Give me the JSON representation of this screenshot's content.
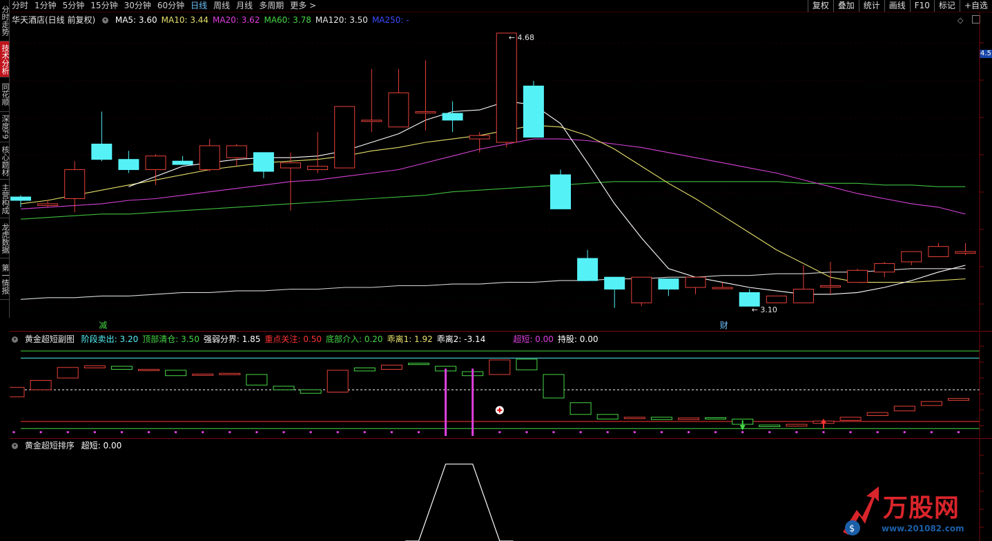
{
  "toolbar": {
    "periods": [
      "分时",
      "1分钟",
      "5分钟",
      "15分钟",
      "30分钟",
      "60分钟",
      "日线",
      "周线",
      "月线",
      "多周期",
      "更多 >"
    ],
    "active_period": "日线",
    "right_buttons": [
      "复权",
      "叠加",
      "统计",
      "画线",
      "F10",
      "标记",
      "+自选"
    ]
  },
  "side_tabs": [
    {
      "label": "分时走势",
      "active": false
    },
    {
      "label": "技术分析",
      "active": true
    },
    {
      "label": "同花顺",
      "active": false
    },
    {
      "label": "深度F9",
      "active": false
    },
    {
      "label": "核心题材",
      "active": false
    },
    {
      "label": "主营构成",
      "active": false
    },
    {
      "label": "龙虎数据",
      "active": false
    },
    {
      "label": "第一情报",
      "active": false
    }
  ],
  "main_header": {
    "stock": "华天酒店(日线 前复权)",
    "ma": [
      {
        "label": "MA5: 3.60",
        "color": "#ffffff"
      },
      {
        "label": "MA10: 3.44",
        "color": "#e6e06a"
      },
      {
        "label": "MA20: 3.62",
        "color": "#e040e0"
      },
      {
        "label": "MA60: 3.78",
        "color": "#46d846"
      },
      {
        "label": "MA120: 3.50",
        "color": "#e6e6e6"
      },
      {
        "label": "MA250: -",
        "color": "#3a4cff"
      }
    ]
  },
  "price_tag": "4.5",
  "colors": {
    "up": "#e8413a",
    "down": "#54f2f7",
    "ma5": "#ffffff",
    "ma10": "#e6e06a",
    "ma20": "#d642d6",
    "ma60": "#3fbf3f",
    "ma120": "#d8d8d8"
  },
  "chart_data": [
    {
      "type": "candlestick",
      "title": "华天酒店(日线 前复权)",
      "candles": [
        {
          "o": 3.72,
          "h": 3.73,
          "l": 3.66,
          "c": 3.7
        },
        {
          "o": 3.67,
          "h": 3.7,
          "l": 3.66,
          "c": 3.68
        },
        {
          "o": 3.71,
          "h": 3.93,
          "l": 3.63,
          "c": 3.88
        },
        {
          "o": 4.03,
          "h": 4.22,
          "l": 3.93,
          "c": 3.94
        },
        {
          "o": 3.94,
          "h": 3.99,
          "l": 3.86,
          "c": 3.88
        },
        {
          "o": 3.88,
          "h": 3.97,
          "l": 3.79,
          "c": 3.96
        },
        {
          "o": 3.93,
          "h": 3.96,
          "l": 3.91,
          "c": 3.91
        },
        {
          "o": 3.88,
          "h": 4.06,
          "l": 3.87,
          "c": 4.02
        },
        {
          "o": 3.95,
          "h": 4.03,
          "l": 3.9,
          "c": 4.02
        },
        {
          "o": 3.98,
          "h": 3.98,
          "l": 3.83,
          "c": 3.87
        },
        {
          "o": 3.89,
          "h": 3.98,
          "l": 3.64,
          "c": 3.92
        },
        {
          "o": 3.88,
          "h": 4.1,
          "l": 3.86,
          "c": 3.9
        },
        {
          "o": 3.89,
          "h": 4.25,
          "l": 3.89,
          "c": 4.25
        },
        {
          "o": 4.17,
          "h": 4.47,
          "l": 4.1,
          "c": 4.17
        },
        {
          "o": 4.13,
          "h": 4.47,
          "l": 4.13,
          "c": 4.33
        },
        {
          "o": 4.22,
          "h": 4.52,
          "l": 4.11,
          "c": 4.22
        },
        {
          "o": 4.21,
          "h": 4.28,
          "l": 4.1,
          "c": 4.17
        },
        {
          "o": 4.06,
          "h": 4.1,
          "l": 3.98,
          "c": 4.08
        },
        {
          "o": 4.04,
          "h": 4.68,
          "l": 4.01,
          "c": 4.68
        },
        {
          "o": 4.37,
          "h": 4.4,
          "l": 4.07,
          "c": 4.07
        },
        {
          "o": 3.85,
          "h": 3.88,
          "l": 3.69,
          "c": 3.65
        },
        {
          "o": 3.36,
          "h": 3.41,
          "l": 3.23,
          "c": 3.23
        },
        {
          "o": 3.25,
          "h": 3.25,
          "l": 3.07,
          "c": 3.18
        },
        {
          "o": 3.1,
          "h": 3.25,
          "l": 3.08,
          "c": 3.25
        },
        {
          "o": 3.24,
          "h": 3.24,
          "l": 3.14,
          "c": 3.18
        },
        {
          "o": 3.19,
          "h": 3.25,
          "l": 3.15,
          "c": 3.25
        },
        {
          "o": 3.19,
          "h": 3.22,
          "l": 3.18,
          "c": 3.19
        },
        {
          "o": 3.16,
          "h": 3.18,
          "l": 3.08,
          "c": 3.08
        },
        {
          "o": 3.1,
          "h": 3.14,
          "l": 3.1,
          "c": 3.14
        },
        {
          "o": 3.1,
          "h": 3.32,
          "l": 3.1,
          "c": 3.18
        },
        {
          "o": 3.2,
          "h": 3.34,
          "l": 3.15,
          "c": 3.2
        },
        {
          "o": 3.22,
          "h": 3.3,
          "l": 3.22,
          "c": 3.29
        },
        {
          "o": 3.28,
          "h": 3.34,
          "l": 3.25,
          "c": 3.33
        },
        {
          "o": 3.34,
          "h": 3.4,
          "l": 3.32,
          "c": 3.4
        },
        {
          "o": 3.37,
          "h": 3.45,
          "l": 3.37,
          "c": 3.43
        },
        {
          "o": 3.39,
          "h": 3.45,
          "l": 3.38,
          "c": 3.4
        }
      ],
      "ma5": [
        null,
        null,
        null,
        null,
        3.78,
        3.84,
        3.9,
        3.92,
        3.94,
        3.95,
        3.95,
        3.96,
        3.99,
        4.04,
        4.09,
        4.17,
        4.22,
        4.23,
        4.28,
        4.26,
        4.15,
        3.92,
        3.68,
        3.48,
        3.3,
        3.25,
        3.22,
        3.19,
        3.17,
        3.15,
        3.15,
        3.16,
        3.19,
        3.23,
        3.28,
        3.32
      ],
      "ma10": [
        3.68,
        3.7,
        3.73,
        3.76,
        3.79,
        3.82,
        3.85,
        3.88,
        3.9,
        3.92,
        3.93,
        3.94,
        3.96,
        3.99,
        4.01,
        4.04,
        4.06,
        4.08,
        4.11,
        4.14,
        4.13,
        4.08,
        4.0,
        3.9,
        3.8,
        3.71,
        3.61,
        3.51,
        3.41,
        3.33,
        3.25,
        3.22,
        3.22,
        3.22,
        3.23,
        3.24
      ],
      "ma20": [
        3.65,
        3.66,
        3.67,
        3.68,
        3.7,
        3.71,
        3.73,
        3.75,
        3.77,
        3.79,
        3.81,
        3.82,
        3.84,
        3.86,
        3.88,
        3.92,
        3.96,
        4.0,
        4.03,
        4.06,
        4.06,
        4.05,
        4.03,
        4.01,
        3.98,
        3.95,
        3.92,
        3.89,
        3.86,
        3.82,
        3.78,
        3.74,
        3.71,
        3.68,
        3.66,
        3.62
      ],
      "ma60": [
        3.59,
        3.6,
        3.61,
        3.62,
        3.62,
        3.63,
        3.64,
        3.65,
        3.66,
        3.67,
        3.68,
        3.69,
        3.7,
        3.71,
        3.72,
        3.73,
        3.75,
        3.76,
        3.77,
        3.78,
        3.79,
        3.8,
        3.81,
        3.81,
        3.81,
        3.81,
        3.81,
        3.81,
        3.81,
        3.8,
        3.8,
        3.8,
        3.79,
        3.79,
        3.78,
        3.78
      ],
      "ma120": [
        3.12,
        3.13,
        3.13,
        3.14,
        3.14,
        3.15,
        3.16,
        3.16,
        3.17,
        3.17,
        3.18,
        3.18,
        3.19,
        3.19,
        3.2,
        3.2,
        3.21,
        3.21,
        3.22,
        3.22,
        3.23,
        3.23,
        3.24,
        3.24,
        3.25,
        3.25,
        3.26,
        3.26,
        3.27,
        3.27,
        3.28,
        3.28,
        3.29,
        3.3,
        3.3,
        3.3
      ],
      "ylim": [
        3.02,
        4.72
      ],
      "annotations": [
        {
          "text": "4.68",
          "index": 18,
          "value": 4.68
        },
        {
          "text": "3.10",
          "index": 27,
          "value": 3.08
        },
        {
          "text": "减",
          "index": 3,
          "kind": "signal",
          "color": "#46d846"
        },
        {
          "text": "财",
          "index": 26,
          "kind": "signal",
          "color": "#6ec3ff"
        }
      ]
    },
    {
      "type": "bar",
      "title": "黄金超短副图",
      "header_items": [
        {
          "label": "阶段卖出: 3.20",
          "color": "#54f2f7"
        },
        {
          "label": "顶部清仓: 3.50",
          "color": "#46d846"
        },
        {
          "label": "强弱分界: 1.85",
          "color": "#ffffff"
        },
        {
          "label": "重点关注: 0.50",
          "color": "#ff3333"
        },
        {
          "label": "底部介入: 0.20",
          "color": "#46d846"
        },
        {
          "label": "乖离1: 1.92",
          "color": "#e6e06a"
        },
        {
          "label": "乖离2: -3.14",
          "color": "#ffffff"
        },
        {
          "label": "超短: 0.00",
          "color": "#e040e0"
        },
        {
          "label": "持股: 0.00",
          "color": "#ffffff"
        }
      ],
      "ref_lines": [
        {
          "value": 3.5,
          "color": "#46d846"
        },
        {
          "value": 3.2,
          "color": "#54f2f7"
        },
        {
          "value": 1.85,
          "color": "#ffffff",
          "dash": true
        },
        {
          "value": 0.5,
          "color": "#ff3333"
        },
        {
          "value": 0.2,
          "color": "#46d846"
        }
      ],
      "boxes": [
        {
          "o": 1.55,
          "c": 1.95,
          "up": true
        },
        {
          "o": 1.85,
          "c": 2.25,
          "up": true
        },
        {
          "o": 2.35,
          "c": 2.8,
          "up": true
        },
        {
          "o": 2.78,
          "c": 2.87,
          "up": true
        },
        {
          "o": 2.85,
          "c": 2.72,
          "up": false
        },
        {
          "o": 2.72,
          "c": 2.7,
          "up": true
        },
        {
          "o": 2.68,
          "c": 2.45,
          "up": false
        },
        {
          "o": 2.48,
          "c": 2.52,
          "up": true
        },
        {
          "o": 2.52,
          "c": 2.55,
          "up": true
        },
        {
          "o": 2.5,
          "c": 2.05,
          "up": false
        },
        {
          "o": 2.0,
          "c": 1.85,
          "up": false
        },
        {
          "o": 1.85,
          "c": 1.7,
          "up": false
        },
        {
          "o": 1.75,
          "c": 2.68,
          "up": true
        },
        {
          "o": 2.78,
          "c": 2.65,
          "up": false
        },
        {
          "o": 2.72,
          "c": 2.9,
          "up": true
        },
        {
          "o": 2.95,
          "c": 2.98,
          "up": false
        },
        {
          "o": 2.85,
          "c": 2.65,
          "up": false
        },
        {
          "o": 2.62,
          "c": 2.45,
          "up": false
        },
        {
          "o": 2.5,
          "c": 3.12,
          "up": true
        },
        {
          "o": 3.15,
          "c": 2.7,
          "up": false
        },
        {
          "o": 2.5,
          "c": 1.5,
          "up": false
        },
        {
          "o": 1.3,
          "c": 0.8,
          "up": false
        },
        {
          "o": 0.8,
          "c": 0.6,
          "up": false
        },
        {
          "o": 0.62,
          "c": 0.68,
          "up": true
        },
        {
          "o": 0.68,
          "c": 0.58,
          "up": false
        },
        {
          "o": 0.58,
          "c": 0.65,
          "up": true
        },
        {
          "o": 0.66,
          "c": 0.62,
          "up": false
        },
        {
          "o": 0.6,
          "c": 0.38,
          "up": false
        },
        {
          "o": 0.35,
          "c": 0.28,
          "up": false
        },
        {
          "o": 0.3,
          "c": 0.38,
          "up": true
        },
        {
          "o": 0.42,
          "c": 0.52,
          "up": true
        },
        {
          "o": 0.55,
          "c": 0.68,
          "up": true
        },
        {
          "o": 0.75,
          "c": 0.88,
          "up": true
        },
        {
          "o": 0.95,
          "c": 1.15,
          "up": true
        },
        {
          "o": 1.18,
          "c": 1.35,
          "up": true
        },
        {
          "o": 1.4,
          "c": 1.48,
          "up": true
        }
      ],
      "spikes": [
        16,
        17
      ],
      "markers": [
        {
          "index": 18,
          "kind": "plus-circle"
        },
        {
          "index": 27,
          "kind": "down-arrow",
          "color": "#46d846"
        },
        {
          "index": 30,
          "kind": "up-arrow",
          "color": "#ff3333"
        }
      ],
      "ylim": [
        0.0,
        4.0
      ]
    },
    {
      "type": "line",
      "title": "黄金超短排序",
      "header_items": [
        {
          "label": "超短: 0.00",
          "color": "#ffffff"
        }
      ],
      "x": [
        14.5,
        15,
        15.5,
        16,
        16.5,
        17,
        17.5,
        18,
        18.5
      ],
      "y": [
        0,
        0,
        0.5,
        1,
        1,
        1,
        0.5,
        0,
        0
      ],
      "ylim": [
        0,
        1.15
      ]
    }
  ],
  "logo": {
    "text": "万股网",
    "url": "www.201082.com"
  }
}
